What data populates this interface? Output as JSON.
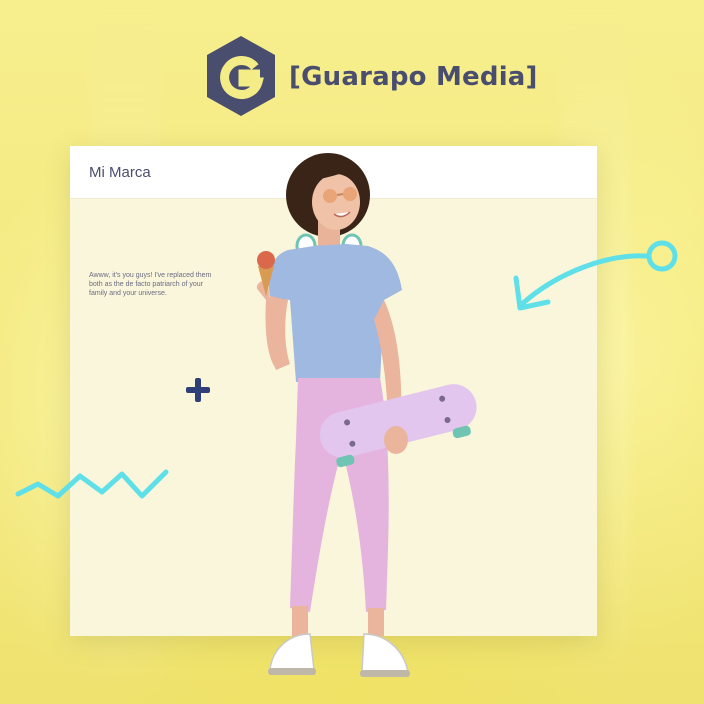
{
  "brand": {
    "name": "[Guarapo Media]",
    "logo_icon": "hexagon-g-logo-icon",
    "color": "#4a4e6e"
  },
  "card": {
    "title": "Mi Marca",
    "body": "Awww, it's you guys! I've replaced them both as the de facto patriarch of your family and your universe."
  },
  "decorations": {
    "plus_icon": "plus-icon",
    "zigzag_icon": "zigzag-icon",
    "arrow_icon": "curved-arrow-icon",
    "accent_cyan": "#5fe0e8",
    "accent_navy": "#2f3f77"
  },
  "colors": {
    "background": "#f4ec86",
    "card": "#faf6dc",
    "card_header": "#ffffff"
  }
}
